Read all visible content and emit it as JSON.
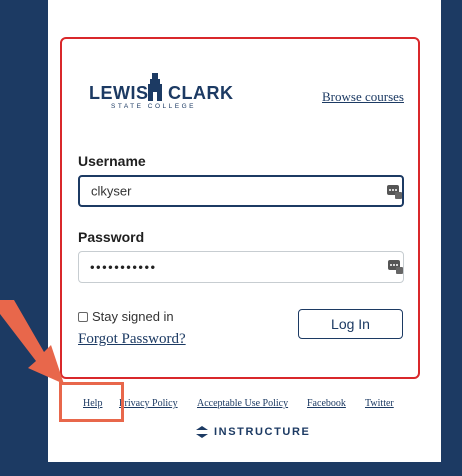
{
  "logo": {
    "left_text": "LEWIS",
    "right_text": "CLARK",
    "sub_text": "STATE COLLEGE"
  },
  "header": {
    "browse_label": "Browse courses"
  },
  "form": {
    "username_label": "Username",
    "username_value": "clkyser",
    "password_label": "Password",
    "password_value": "•••••••••••",
    "stay_signed_in_label": "Stay signed in",
    "forgot_label": "Forgot Password?",
    "login_label": "Log In"
  },
  "footer": {
    "links": [
      "Help",
      "Privacy Policy",
      "Acceptable Use Policy",
      "Facebook",
      "Twitter"
    ],
    "brand": "INSTRUCTURE"
  },
  "colors": {
    "navy": "#1c3a63",
    "box_border": "#d9282b",
    "annotation": "#e8674b"
  },
  "icons": [
    "password-manager-icon",
    "instructure-icon",
    "tower-icon"
  ]
}
